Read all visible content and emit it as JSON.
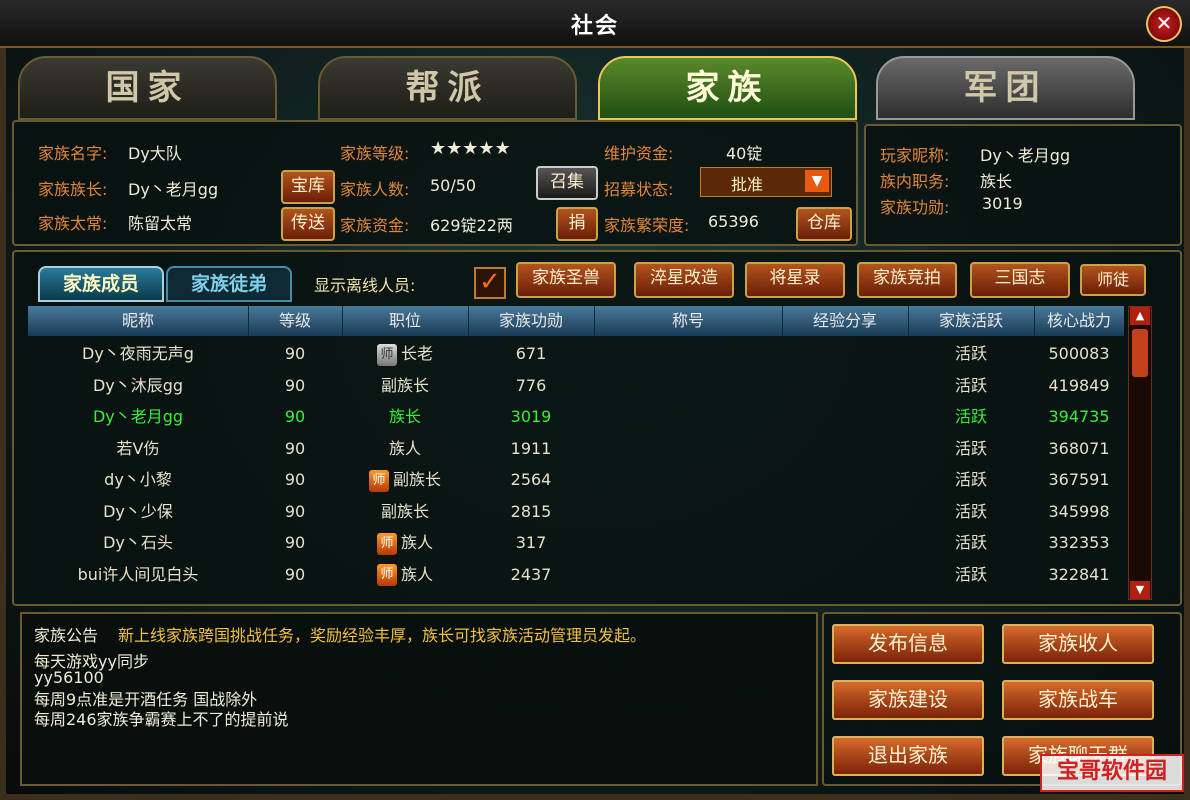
{
  "window": {
    "title": "社会",
    "close": "✕"
  },
  "tabs": [
    {
      "label": "国家"
    },
    {
      "label": "帮派"
    },
    {
      "label": "家族"
    },
    {
      "label": "军团"
    }
  ],
  "family": {
    "name_label": "家族名字:",
    "name_value": "Dy大队",
    "leader_label": "家族族长:",
    "leader_value": "Dy丶老月gg",
    "elder_label": "家族太常:",
    "elder_value": "陈留太常",
    "level_label": "家族等级:",
    "level_value": "★★★★★",
    "members_label": "家族人数:",
    "members_value": "50/50",
    "funds_label": "家族资金:",
    "funds_value": "629锭22两",
    "upkeep_label": "维护资金:",
    "upkeep_value": "40锭",
    "recruit_label": "招募状态:",
    "recruit_value": "批准",
    "prosperity_label": "家族繁荣度:",
    "prosperity_value": "65396",
    "btn_treasury": "宝库",
    "btn_teleport": "传送",
    "btn_summon": "召集",
    "btn_donate": "捐",
    "btn_warehouse": "仓库"
  },
  "player": {
    "nick_label": "玩家昵称:",
    "nick_value": "Dy丶老月gg",
    "role_label": "族内职务:",
    "role_value": "族长",
    "merit_label": "家族功勋:",
    "merit_value": "3019"
  },
  "subtabs": {
    "members": "家族成员",
    "apprentices": "家族徒弟"
  },
  "show_offline": "显示离线人员:",
  "toolbar": [
    "家族圣兽",
    "淬星改造",
    "将星录",
    "家族竞拍",
    "三国志",
    "师徒"
  ],
  "columns": [
    "昵称",
    "等级",
    "职位",
    "家族功勋",
    "称号",
    "经验分享",
    "家族活跃",
    "核心战力"
  ],
  "rows": [
    {
      "name": "Dy丶夜雨无声g",
      "level": "90",
      "badge": "师",
      "badge_type": "gray",
      "role": "长老",
      "merit": "671",
      "activity": "活跃",
      "power": "500083"
    },
    {
      "name": "Dy丶沐辰gg",
      "level": "90",
      "badge": "",
      "badge_type": "",
      "role": "副族长",
      "merit": "776",
      "activity": "活跃",
      "power": "419849"
    },
    {
      "name": "Dy丶老月gg",
      "level": "90",
      "badge": "",
      "badge_type": "",
      "role": "族长",
      "merit": "3019",
      "activity": "活跃",
      "power": "394735",
      "me": true
    },
    {
      "name": "若V伤",
      "level": "90",
      "badge": "",
      "badge_type": "",
      "role": "族人",
      "merit": "1911",
      "activity": "活跃",
      "power": "368071"
    },
    {
      "name": "dy丶小黎",
      "level": "90",
      "badge": "师",
      "badge_type": "orange",
      "role": "副族长",
      "merit": "2564",
      "activity": "活跃",
      "power": "367591"
    },
    {
      "name": "Dy丶少保",
      "level": "90",
      "badge": "",
      "badge_type": "",
      "role": "副族长",
      "merit": "2815",
      "activity": "活跃",
      "power": "345998"
    },
    {
      "name": "Dy丶石头",
      "level": "90",
      "badge": "师",
      "badge_type": "orange",
      "role": "族人",
      "merit": "317",
      "activity": "活跃",
      "power": "332353"
    },
    {
      "name": "bui许人间见白头",
      "level": "90",
      "badge": "师",
      "badge_type": "orange",
      "role": "族人",
      "merit": "2437",
      "activity": "活跃",
      "power": "322841"
    }
  ],
  "notice": {
    "label": "家族公告",
    "headline": "新上线家族跨国挑战任务，奖励经验丰厚，族长可找家族活动管理员发起。",
    "lines": [
      "每天游戏yy同步",
      "yy56100",
      "每周9点准是开酒任务  国战除外",
      "每周246家族争霸赛上不了的提前说"
    ]
  },
  "actions": [
    "发布信息",
    "家族收人",
    "家族建设",
    "家族战车",
    "退出家族",
    "家族聊天群"
  ],
  "watermark": "宝哥软件园",
  "colors": {
    "accent": "#e0863a",
    "self": "#3aee3a",
    "button": "#b2541c"
  }
}
